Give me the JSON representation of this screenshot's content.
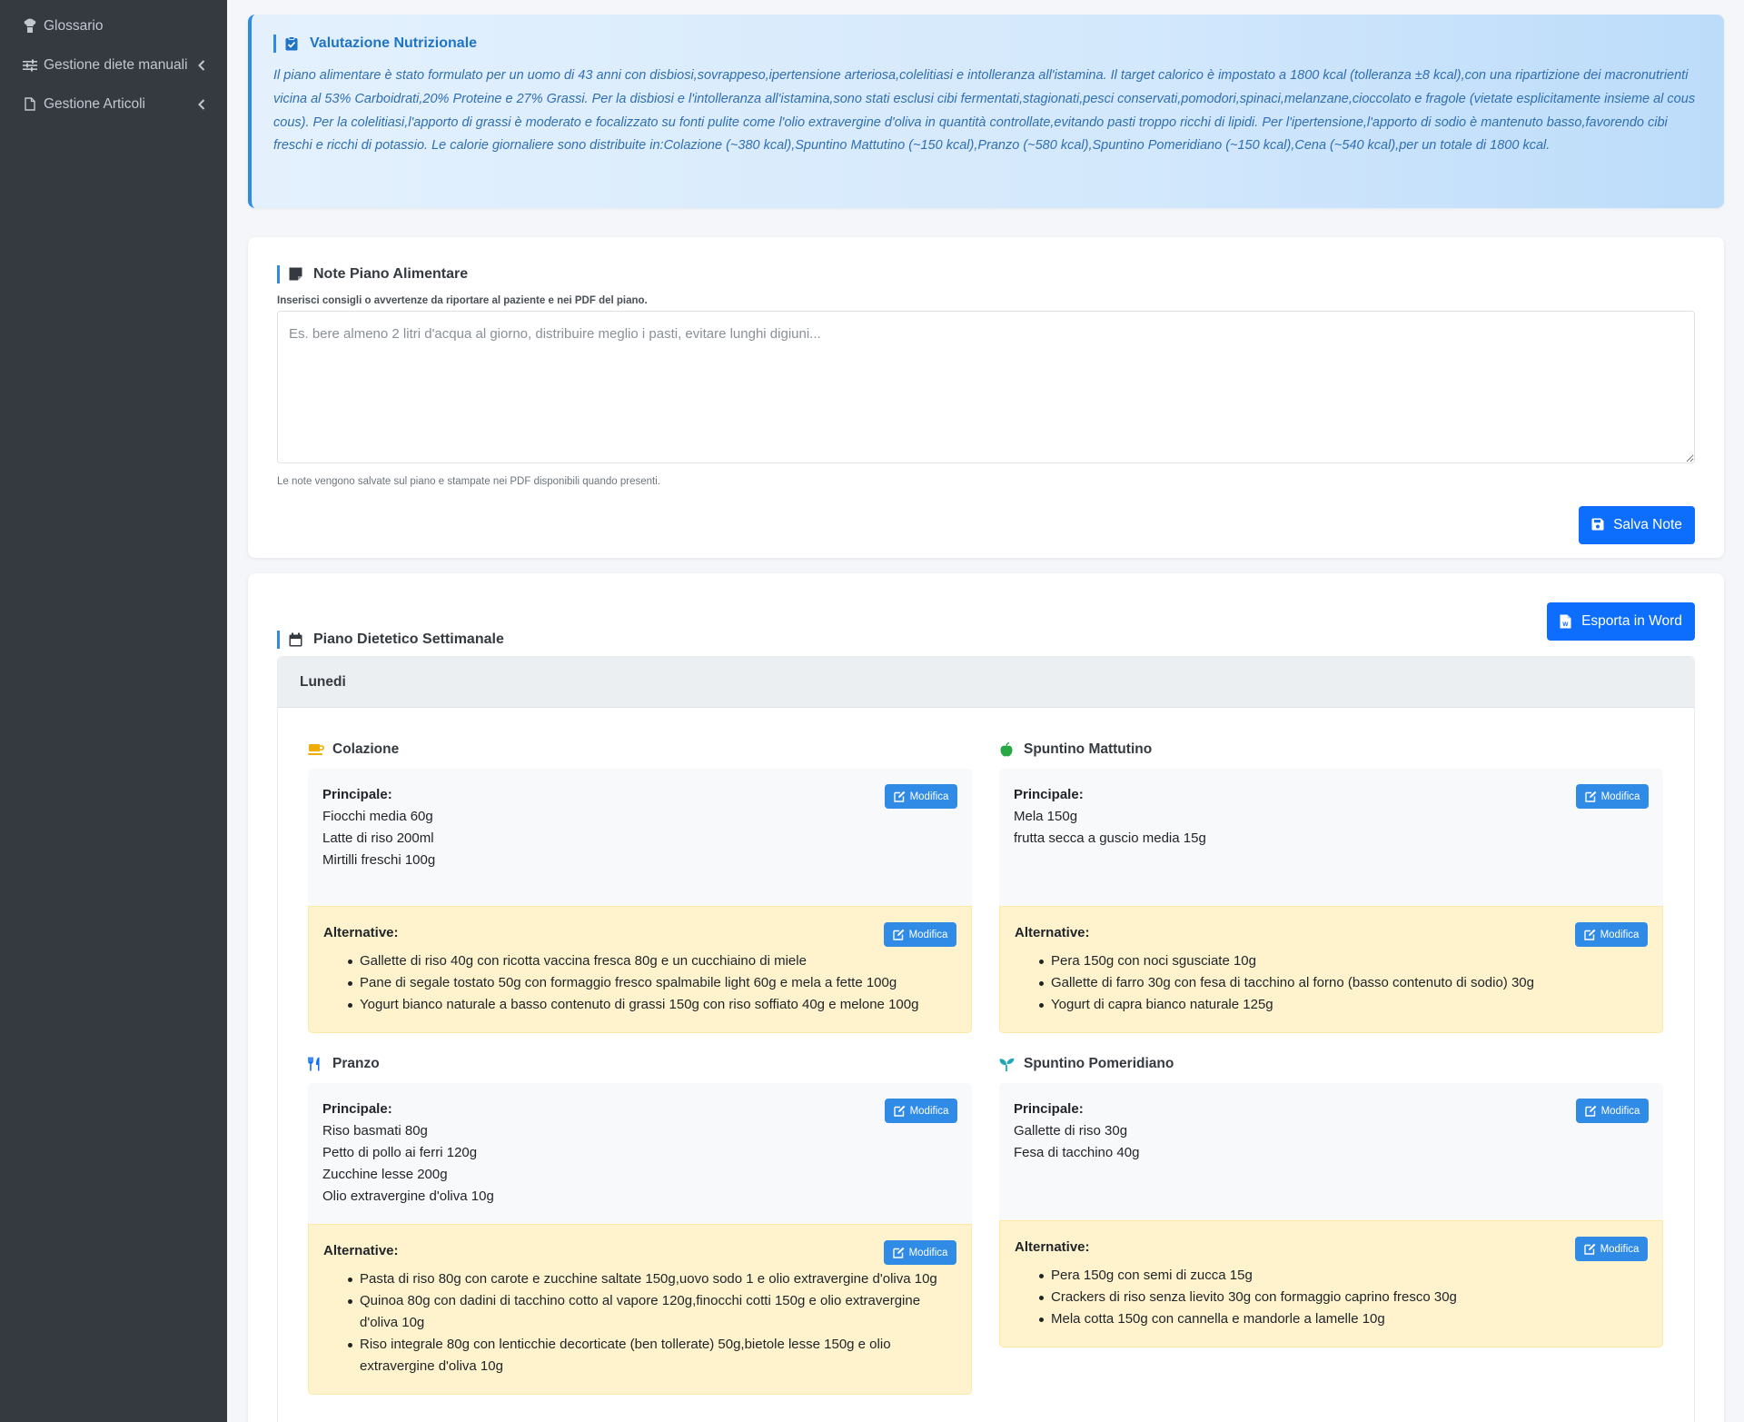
{
  "sidebar": {
    "items": [
      {
        "label": "Glossario",
        "icon": "chef-icon"
      },
      {
        "label": "Gestione diete manuali",
        "icon": "sliders-icon"
      },
      {
        "label": "Gestione Articoli",
        "icon": "document-icon"
      }
    ]
  },
  "evaluation": {
    "title": "Valutazione Nutrizionale",
    "text": "Il piano alimentare è stato formulato per un uomo di 43 anni con disbiosi,sovrappeso,ipertensione arteriosa,colelitiasi e intolleranza all'istamina. Il target calorico è impostato a 1800 kcal (tolleranza ±8 kcal),con una ripartizione dei macronutrienti vicina al 53% Carboidrati,20% Proteine e 27% Grassi. Per la disbiosi e l'intolleranza all'istamina,sono stati esclusi cibi fermentati,stagionati,pesci conservati,pomodori,spinaci,melanzane,cioccolato e fragole (vietate esplicitamente insieme al cous cous). Per la colelitiasi,l'apporto di grassi è moderato e focalizzato su fonti pulite come l'olio extravergine d'oliva in quantità controllate,evitando pasti troppo ricchi di lipidi. Per l'ipertensione,l'apporto di sodio è mantenuto basso,favorendo cibi freschi e ricchi di potassio. Le calorie giornaliere sono distribuite in:Colazione (~380 kcal),Spuntino Mattutino (~150 kcal),Pranzo (~580 kcal),Spuntino Pomeridiano (~150 kcal),Cena (~540 kcal),per un totale di 1800 kcal."
  },
  "notes": {
    "title": "Note Piano Alimentare",
    "help": "Inserisci consigli o avvertenze da riportare al paziente e nei PDF del piano.",
    "value": "",
    "placeholder": "Es. bere almeno 2 litri d'acqua al giorno, distribuire meglio i pasti, evitare lunghi digiuni...",
    "footer": "Le note vengono salvate sul piano e stampate nei PDF disponibili quando presenti.",
    "save_label": "Salva Note"
  },
  "plan": {
    "title": "Piano Dietetico Settimanale",
    "export_label": "Esporta in Word",
    "day": "Lunedi",
    "principal_label": "Principale:",
    "alternative_label": "Alternative:",
    "modify_label": "Modifica",
    "meals": [
      {
        "name": "Colazione",
        "icon": "coffee-icon",
        "icon_color": "#f0ad00",
        "principal": [
          "Fiocchi media 60g",
          "Latte di riso 200ml",
          "Mirtilli freschi 100g"
        ],
        "alternatives": [
          "Gallette di riso 40g con ricotta vaccina fresca 80g e un cucchiaino di miele",
          "Pane di segale tostato 50g con formaggio fresco spalmabile light 60g e mela a fette 100g",
          "Yogurt bianco naturale a basso contenuto di grassi 150g con riso soffiato 40g e melone 100g"
        ]
      },
      {
        "name": "Spuntino Mattutino",
        "icon": "apple-icon",
        "icon_color": "#28a745",
        "principal": [
          "Mela 150g",
          "frutta secca a guscio media 15g"
        ],
        "alternatives": [
          "Pera 150g con noci sgusciate 10g",
          "Gallette di farro 30g con fesa di tacchino al forno (basso contenuto di sodio) 30g",
          "Yogurt di capra bianco naturale 125g"
        ]
      },
      {
        "name": "Pranzo",
        "icon": "utensils-icon",
        "icon_color": "#0d6efd",
        "principal": [
          "Riso basmati 80g",
          "Petto di pollo ai ferri 120g",
          "Zucchine lesse 200g",
          "Olio extravergine d'oliva 10g"
        ],
        "alternatives": [
          "Pasta di riso 80g con carote e zucchine saltate 150g,uovo sodo 1 e olio extravergine d'oliva 10g",
          "Quinoa 80g con dadini di tacchino cotto al vapore 120g,finocchi cotti 150g e olio extravergine d'oliva 10g",
          "Riso integrale 80g con lenticchie decorticate (ben tollerate) 50g,bietole lesse 150g e olio extravergine d'oliva 10g"
        ]
      },
      {
        "name": "Spuntino Pomeridiano",
        "icon": "seedling-icon",
        "icon_color": "#20a8b8",
        "principal": [
          "Gallette di riso 30g",
          "Fesa di tacchino 40g"
        ],
        "alternatives": [
          "Pera 150g con semi di zucca 15g",
          "Crackers di riso senza lievito 30g con formaggio caprino fresco 30g",
          "Mela cotta 150g con cannella e mandorle a lamelle 10g"
        ]
      }
    ]
  }
}
